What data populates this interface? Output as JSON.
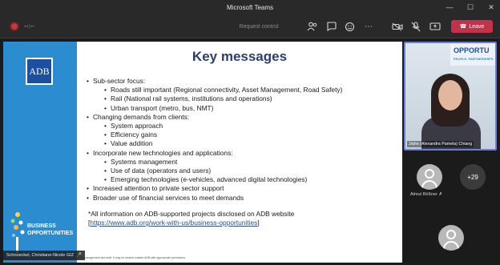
{
  "window": {
    "title": "Microsoft Teams"
  },
  "toolbar": {
    "timer": "--:--",
    "request_control": "Request control",
    "leave_label": "Leave"
  },
  "slide": {
    "logo_text": "ADB",
    "title": "Key messages",
    "bo_logo_line1": "BUSINESS",
    "bo_logo_line2": "OPPORTUNITIES",
    "bullets": [
      {
        "level": 1,
        "text": "Sub-sector focus:"
      },
      {
        "level": 2,
        "text": "Roads still important (Regional connectivity, Asset Management, Road Safety)"
      },
      {
        "level": 2,
        "text": "Rail (National rail systems, institutions and operations)"
      },
      {
        "level": 2,
        "text": "Urban transport (metro, bus, NMT)"
      },
      {
        "level": 1,
        "text": "Changing demands from clients:"
      },
      {
        "level": 2,
        "text": "System approach"
      },
      {
        "level": 2,
        "text": "Efficiency gains"
      },
      {
        "level": 2,
        "text": "Value addition"
      },
      {
        "level": 1,
        "text": "Incorporate new technologies and applications:"
      },
      {
        "level": 2,
        "text": "Systems management"
      },
      {
        "level": 2,
        "text": "Use of data (operators and users)"
      },
      {
        "level": 2,
        "text": "Emerging technologies (e-vehicles, advanced digital technologies)"
      },
      {
        "level": 1,
        "text": "Increased attention to private sector support"
      },
      {
        "level": 1,
        "text": "Broader use of financial services to meet demands"
      }
    ],
    "info_text": "*All information on ADB-supported projects disclosed on ADB website",
    "link_open": "[",
    "link_text": "https://www.adb.org/work-with-us/business-opportunities",
    "link_close": "]",
    "footnote": "ADB management and staff. It may be shared outside ADB with appropriate permission.",
    "presenter_name": "Schnoeckel, Christiane-Nicole GIZ"
  },
  "participants": {
    "video_name": "Jiahe (Alexandra Pamela) Chiang",
    "video_banner_1": "OPPORTU",
    "video_banner_2": "PEOPLE. PARTNERSHIPS",
    "tile_name": "Almut Rößner",
    "more_count": "+29"
  },
  "colors": {
    "leave": "#c4314b",
    "slide_side": "#2b8ccf",
    "adb_blue": "#1b4fa0",
    "title": "#2a3f6b",
    "active_speaker_border": "#6c7fd8"
  }
}
